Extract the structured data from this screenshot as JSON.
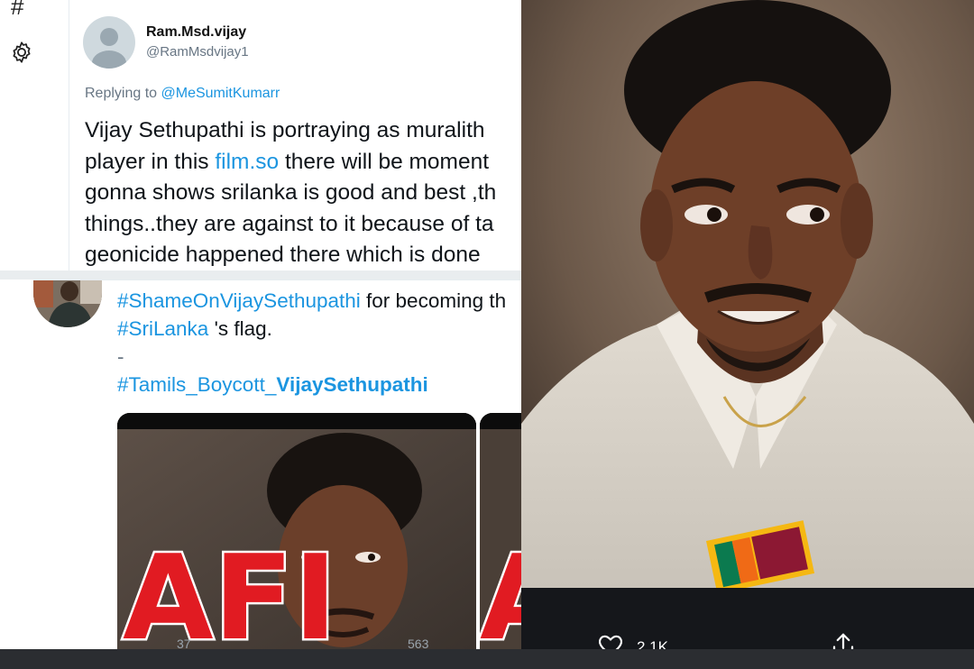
{
  "sidebar": {
    "hash_glyph": "#",
    "settings_icon": "gear-icon"
  },
  "tweet": {
    "display_name": "Ram.Msd.vijay",
    "handle": "@RamMsdvijay1",
    "replying_prefix": "Replying to",
    "replying_to": "@MeSumitKumarr",
    "line1": "Vijay Sethupathi is portraying as  muralith",
    "line2_a": "player in this ",
    "line2_link": "film.so",
    "line2_b": " there will be moment",
    "line3": "gonna shows srilanka is good and best ,th",
    "line4": "things..they are against to it because of ta",
    "line5": "geonicide happened there which is done"
  },
  "quoted": {
    "hashtag1": "#ShameOnVijaySethupathi",
    "line1_rest": " for becoming th",
    "hashtag2": "#SriLanka",
    "line2_rest": " 's flag.",
    "dash": "-",
    "hashtag3_a": "#Tamils_Boycott_",
    "hashtag3_b": "VijaySethupathi",
    "poster_text": "AFI",
    "poster_text_2": "A",
    "ghost_reply_count": "37",
    "ghost_retweet_count": "563"
  },
  "viewer": {
    "like_count": "2.1K",
    "like_icon": "heart-icon",
    "share_icon": "share-icon"
  },
  "colors": {
    "link": "#1b95e0",
    "secondary_text": "#687684",
    "action_bar": "#15171b",
    "poster_red": "#e11b22"
  }
}
